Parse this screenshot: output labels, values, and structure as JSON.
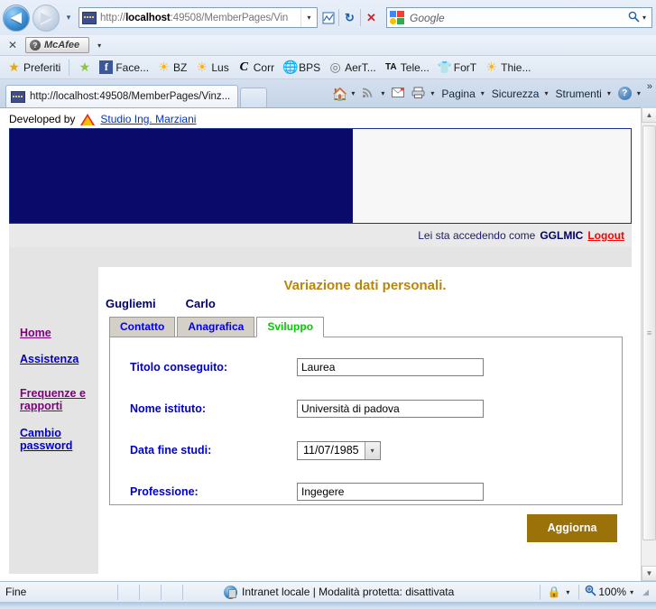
{
  "browser": {
    "nav": {
      "back_label": "◀",
      "forward_label": "▶",
      "recent_pages_label": "▾"
    },
    "address_bar": {
      "url_prefix": "http://",
      "url_host": "localhost",
      "url_rest": ":49508/MemberPages/Vin",
      "dropdown_label": "▾",
      "favicon_name": "site-favicon"
    },
    "toolbar_buttons": {
      "compatibility_label": "⧉",
      "refresh_label": "↻",
      "stop_label": "✕"
    },
    "search": {
      "provider": "Google",
      "placeholder": "Google",
      "go_label": "🔍",
      "dropdown_label": "▾"
    },
    "mcafee_bar": {
      "close_label": "✕",
      "badge_label": "?",
      "name": "McAfee",
      "dropdown_label": "▾"
    },
    "favorites_bar": {
      "favorites_label": "Preferiti",
      "add_label": "",
      "items": [
        {
          "label": "Face...",
          "icon": "facebook-icon"
        },
        {
          "label": "BZ",
          "icon": "sun-icon"
        },
        {
          "label": "Lus",
          "icon": "sun-icon"
        },
        {
          "label": "Corr",
          "icon": "corriere-icon"
        },
        {
          "label": "BPS",
          "icon": "globe-icon"
        },
        {
          "label": "AerT...",
          "icon": "ring-icon"
        },
        {
          "label": "Tele...",
          "icon": "ta-icon"
        },
        {
          "label": "ForT",
          "icon": "shirt-icon"
        },
        {
          "label": "Thie...",
          "icon": "sun-icon"
        }
      ]
    },
    "tab": {
      "title": "http://localhost:49508/MemberPages/Vinz...",
      "new_tab_label": ""
    },
    "command_bar": {
      "home_label": "",
      "feeds_label": "",
      "mail_label": "",
      "print_label": "",
      "page_label": "Pagina",
      "security_label": "Sicurezza",
      "tools_label": "Strumenti",
      "help_label": "?",
      "overflow_label": "»",
      "caret": "▾"
    }
  },
  "page": {
    "developed_by": {
      "prefix": "Developed by",
      "link": "Studio Ing. Marziani"
    },
    "login_bar": {
      "text": "Lei sta accedendo come",
      "username": "GGLMIC",
      "logout_label": "Logout"
    },
    "sidebar": {
      "items": [
        {
          "label": "Home",
          "state": "visited"
        },
        {
          "label": "Assistenza",
          "state": "unvisited"
        },
        {
          "label": "Frequenze e rapporti",
          "state": "visited"
        },
        {
          "label": "Cambio password",
          "state": "unvisited"
        }
      ]
    },
    "main": {
      "title": "Variazione dati personali.",
      "person": {
        "surname": "Gugliemi",
        "name": "Carlo"
      },
      "tabs": [
        {
          "label": "Contatto",
          "active": false
        },
        {
          "label": "Anagrafica",
          "active": false
        },
        {
          "label": "Sviluppo",
          "active": true
        }
      ],
      "fields": [
        {
          "label": "Titolo conseguito:",
          "value": "Laurea",
          "type": "text"
        },
        {
          "label": "Nome istituto:",
          "value": "Università di padova",
          "type": "text"
        },
        {
          "label": "Data fine studi:",
          "value": "11/07/1985",
          "type": "select"
        },
        {
          "label": "Professione:",
          "value": "Ingegere",
          "type": "text"
        }
      ],
      "submit_label": "Aggiorna"
    },
    "scrollbar": {
      "up_label": "▲",
      "down_label": "▼",
      "grip_label": "≡"
    }
  },
  "status_bar": {
    "status_text": "Fine",
    "zone_text": "Intranet locale | Modalità protetta: disattivata",
    "zoom_level": "100%",
    "caret": "▾"
  },
  "colors": {
    "banner_navy": "#0a0a6b",
    "title_gold": "#b8860b",
    "button_gold": "#9a7209",
    "active_tab_green": "#00cc00",
    "tab_blue": "#0000ee",
    "label_blue": "#0000cc",
    "logout_red": "#ff0000",
    "visited_purple": "#800080"
  }
}
